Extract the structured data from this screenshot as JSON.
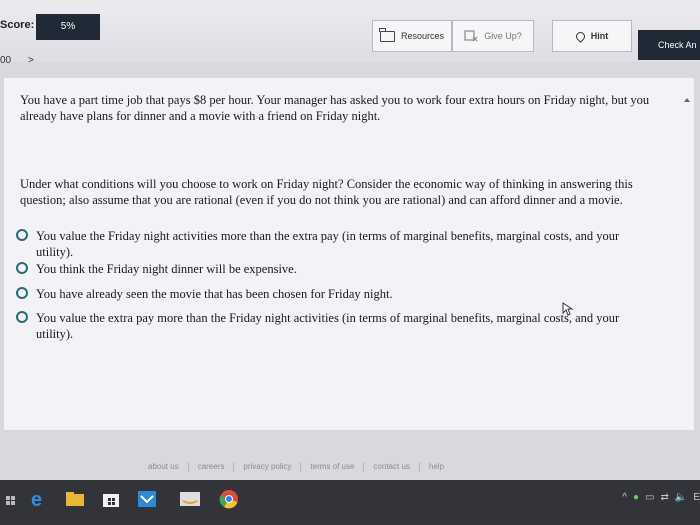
{
  "header": {
    "score_label": "Score:",
    "score_value": "5%",
    "resources_label": "Resources",
    "give_up_label": "Give Up?",
    "hint_label": "Hint",
    "check_label": "Check An"
  },
  "nav": {
    "left": "00",
    "right": ">"
  },
  "question": {
    "scenario": "You have a part time job that pays $8 per hour. Your manager has asked you to work four extra hours on Friday night, but you already have plans for dinner and a movie with a friend on Friday night.",
    "prompt": "Under what conditions will you choose to work on Friday night? Consider the economic way of thinking in answering this question; also assume that you are rational (even if you do not think you are rational) and can afford dinner and a movie.",
    "options": [
      "You value the Friday night activities more than the extra pay (in terms of marginal benefits, marginal costs, and your utility).",
      "You think the Friday night dinner will be expensive.",
      "You have already seen the movie that has been chosen for Friday night.",
      "You value the extra pay more than the Friday night activities (in terms of marginal benefits, marginal costs, and your utility)."
    ]
  },
  "footer": {
    "links": [
      "about us",
      "careers",
      "privacy policy",
      "terms of use",
      "contact us",
      "help"
    ]
  },
  "taskbar": {
    "tray_text": "E"
  },
  "colors": {
    "header_dark": "#1f2a36",
    "radio_accent": "#2b6a78",
    "taskbar": "#33333a"
  }
}
